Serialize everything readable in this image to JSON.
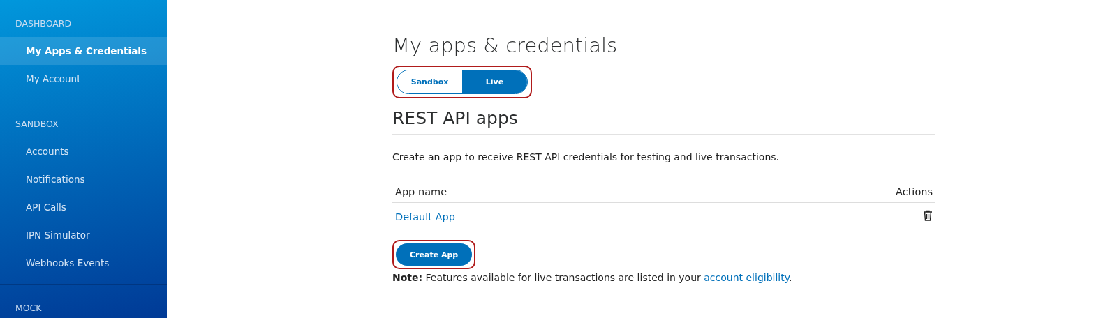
{
  "sidebar": {
    "sections": [
      {
        "title": "DASHBOARD",
        "items": [
          {
            "label": "My Apps & Credentials",
            "selected": true
          },
          {
            "label": "My Account",
            "selected": false
          }
        ]
      },
      {
        "title": "SANDBOX",
        "items": [
          {
            "label": "Accounts",
            "selected": false
          },
          {
            "label": "Notifications",
            "selected": false
          },
          {
            "label": "API Calls",
            "selected": false
          },
          {
            "label": "IPN Simulator",
            "selected": false
          },
          {
            "label": "Webhooks Events",
            "selected": false
          }
        ]
      },
      {
        "title": "MOCK"
      }
    ]
  },
  "page_title": "My apps & credentials",
  "environment_toggle": {
    "highlighted": true,
    "options": [
      {
        "label": "Sandbox",
        "selected": false
      },
      {
        "label": "Live",
        "selected": true
      }
    ]
  },
  "section_title": "REST API apps",
  "description": "Create an app to receive REST API credentials for testing and live transactions.",
  "table": {
    "columns": [
      "App name",
      "Actions"
    ],
    "rows": [
      {
        "name": "Default App"
      }
    ]
  },
  "create_button": {
    "label": "Create App",
    "highlighted": true
  },
  "note": {
    "text": "**Note:** Features available for live transactions are listed in your ",
    "link": "account eligibility",
    "end": "."
  }
}
